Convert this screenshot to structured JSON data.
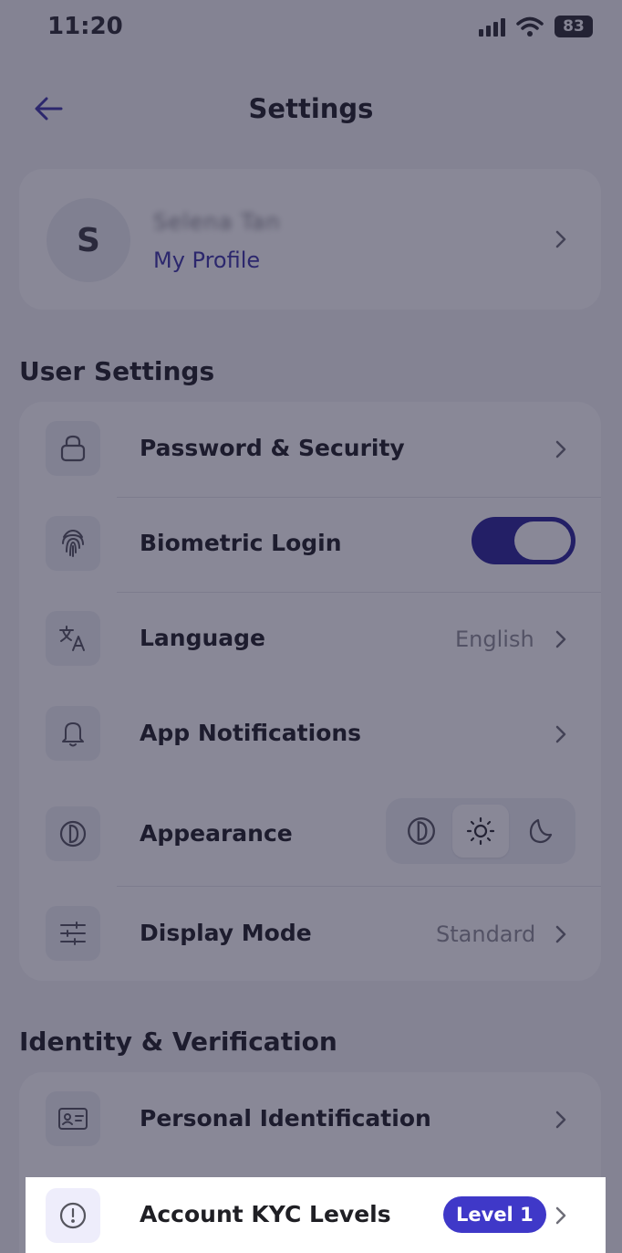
{
  "status_bar": {
    "time": "11:20",
    "battery": "83"
  },
  "header": {
    "title": "Settings"
  },
  "profile": {
    "avatar_initial": "S",
    "name": "Selena Tan",
    "link_label": "My Profile"
  },
  "user_settings": {
    "title": "User Settings",
    "items": [
      {
        "label": "Password & Security",
        "icon": "lock-icon"
      },
      {
        "label": "Biometric Login",
        "icon": "fingerprint-icon",
        "toggle_on": true
      },
      {
        "label": "Language",
        "icon": "translate-icon",
        "value": "English"
      },
      {
        "label": "App Notifications",
        "icon": "bell-icon"
      },
      {
        "label": "Appearance",
        "icon": "contrast-icon",
        "options": [
          "system",
          "light",
          "dark"
        ],
        "selected": "light"
      },
      {
        "label": "Display Mode",
        "icon": "sliders-icon",
        "value": "Standard"
      }
    ]
  },
  "identity": {
    "title": "Identity & Verification",
    "items": [
      {
        "label": "Personal Identification",
        "icon": "id-card-icon"
      },
      {
        "label": "Account KYC Levels",
        "icon": "alert-circle-icon",
        "badge": "Level 1"
      }
    ]
  },
  "colors": {
    "accent": "#3f38c8",
    "toggle": "#2b259a",
    "link": "#3d36a8",
    "overlay": "rgba(28,26,56,0.52)"
  }
}
